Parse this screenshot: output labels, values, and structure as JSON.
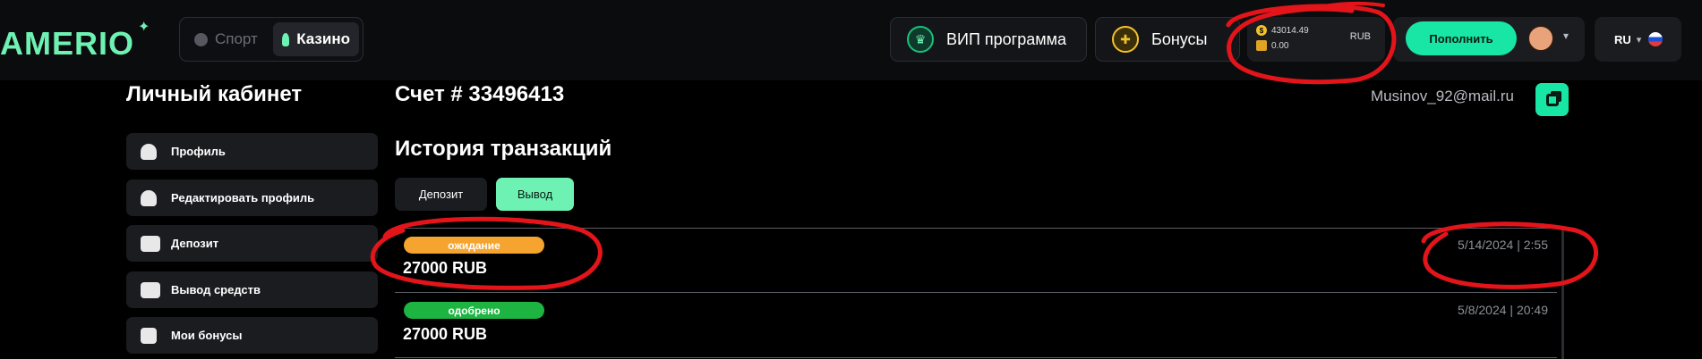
{
  "header": {
    "logo": "AMERIO",
    "logo_star": "✦",
    "modes": {
      "sport": "Спорт",
      "casino": "Казино"
    },
    "vip_label": "ВИП программа",
    "bonus_label": "Бонусы",
    "balance": {
      "main": "43014.49",
      "bonus": "0.00",
      "currency": "RUB"
    },
    "deposit_label": "Пополнить",
    "language": "RU"
  },
  "sidebar": {
    "title": "Личный кабинет",
    "items": [
      {
        "label": "Профиль",
        "icon": "user-icon"
      },
      {
        "label": "Редактировать профиль",
        "icon": "user-edit-icon"
      },
      {
        "label": "Депозит",
        "icon": "deposit-icon"
      },
      {
        "label": "Вывод средств",
        "icon": "withdraw-card-icon"
      },
      {
        "label": "Мои бонусы",
        "icon": "gift-icon"
      }
    ]
  },
  "main": {
    "account_title": "Счет # 33496413",
    "email": "Musinov_92@mail.ru",
    "history_title": "История транзакций",
    "tabs": {
      "deposit": "Депозит",
      "withdraw": "Вывод"
    },
    "transactions": [
      {
        "status": "ожидание",
        "amount": "27000 RUB",
        "date": "5/14/2024 | 2:55",
        "status_color": "#f5a42f"
      },
      {
        "status": "одобрено",
        "amount": "27000 RUB",
        "date": "5/8/2024 | 20:49",
        "status_color": "#1db442"
      }
    ]
  },
  "colors": {
    "accent": "#18e6a4",
    "brand": "#6ef2b3",
    "annotation": "#e3141a"
  }
}
